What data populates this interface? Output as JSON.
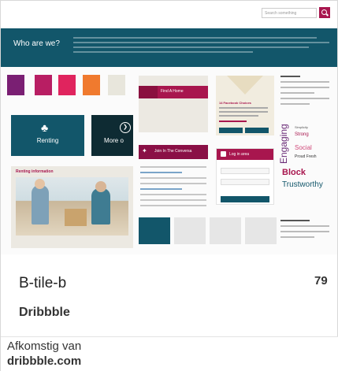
{
  "preview": {
    "banner_title": "Who are we?",
    "search_placeholder": "Search something",
    "swatch_colors": [
      "#7a1f73",
      "#b81e63",
      "#e0245e",
      "#f07a2e",
      "#e8e6dc"
    ],
    "tile_renting_label": "Renting",
    "tile_more_label": "More o",
    "renting_info_title": "Renting information",
    "nav_find_home": "Find A Home",
    "twitter_label": "Join In The Conversa",
    "facebook_card_title": "14 Facebook Choices",
    "login_label": "Log in area",
    "words": {
      "engaging": "Engaging",
      "simplicity": "Simplicity",
      "strong": "Strong",
      "social": "Social",
      "proud_fresh": "Proud Fresh",
      "block": "Block",
      "trustworthy": "Trustworthy"
    },
    "bottom_swatches": [
      "#12566a",
      "#e6e6e6",
      "#e6e6e6",
      "#e6e6e6"
    ]
  },
  "card": {
    "title": "B-tile-b",
    "count": "79",
    "source": "Dribbble"
  },
  "attribution": {
    "prefix": "Afkomstig van",
    "domain": "dribbble.com"
  }
}
